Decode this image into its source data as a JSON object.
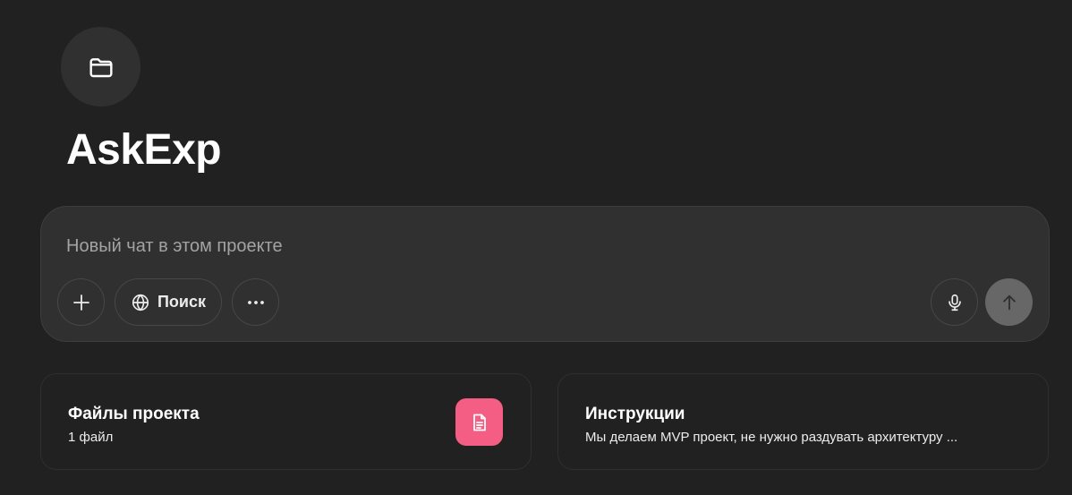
{
  "project": {
    "icon": "folder-icon",
    "title": "AskExp"
  },
  "composer": {
    "placeholder": "Новый чат в этом проекте",
    "add_icon": "plus-icon",
    "search_icon": "globe-icon",
    "search_label": "Поиск",
    "more_icon": "ellipsis-icon",
    "mic_icon": "microphone-icon",
    "send_icon": "arrow-up-icon"
  },
  "cards": {
    "files": {
      "title": "Файлы проекта",
      "subtitle": "1 файл",
      "icon": "document-icon",
      "accent_color": "#f45d84"
    },
    "instructions": {
      "title": "Инструкции",
      "subtitle": "Мы делаем MVP проект, не нужно раздувать архитектуру ..."
    }
  }
}
